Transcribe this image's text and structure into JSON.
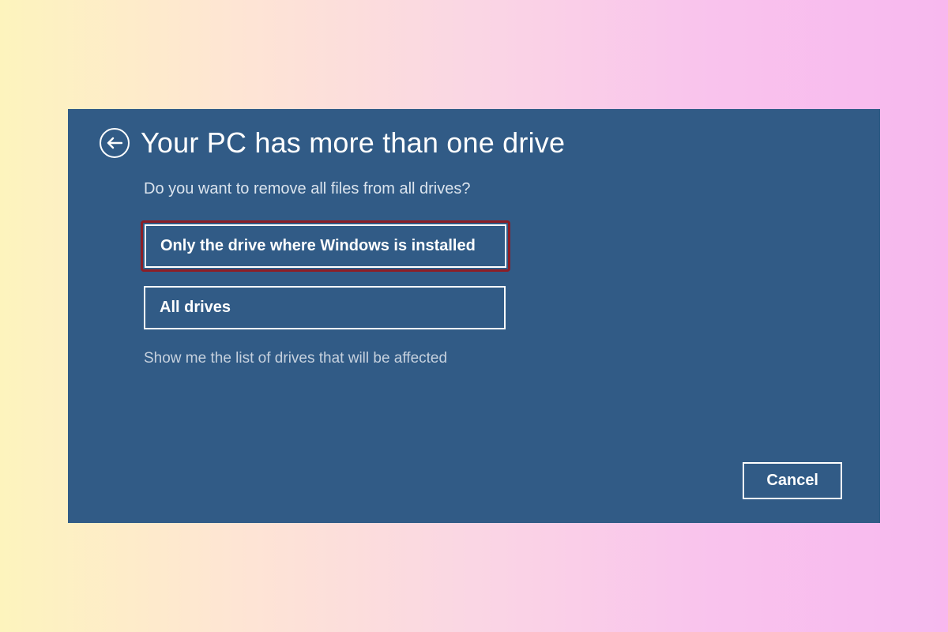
{
  "dialog": {
    "title": "Your PC has more than one drive",
    "subtitle": "Do you want to remove all files from all drives?",
    "options": [
      {
        "label": "Only the drive where Windows is installed",
        "highlighted": true
      },
      {
        "label": "All drives",
        "highlighted": false
      }
    ],
    "link": "Show me the list of drives that will be affected",
    "cancel_label": "Cancel"
  }
}
